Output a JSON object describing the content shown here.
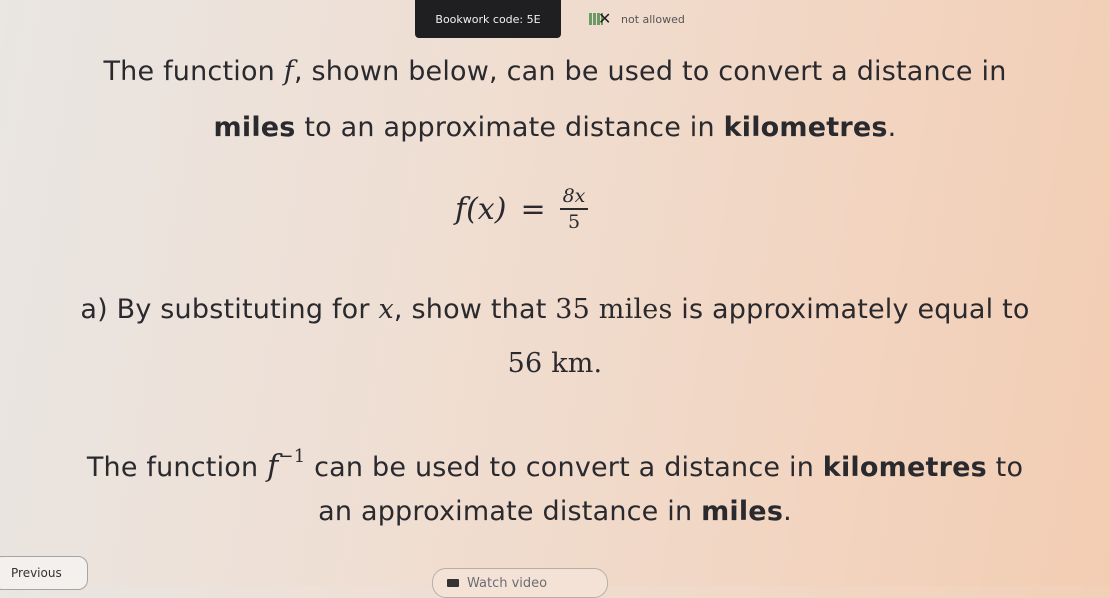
{
  "header": {
    "bookwork": "Bookwork code: 5E",
    "calculator_text": "not allowed",
    "calculator_icon": "calculator-not-allowed-icon"
  },
  "question": {
    "intro_1": "The function ",
    "intro_f": "f",
    "intro_2": ", shown below, can be used to convert a distance in",
    "intro_miles": "miles",
    "intro_3": " to an approximate distance in ",
    "intro_km": "kilometres",
    "intro_4": ".",
    "formula_lhs": "f(x)",
    "formula_eq": "=",
    "formula_num": "8x",
    "formula_den": "5",
    "part_a_1": "a) By substituting for ",
    "part_a_x": "x",
    "part_a_2": ", show that ",
    "part_a_35": "35 miles",
    "part_a_3": " is approximately equal to",
    "part_a_56": "56 km.",
    "inv_1": "The function ",
    "inv_f": "f",
    "inv_exp": "−1",
    "inv_2": " can be used to convert a distance in ",
    "inv_km": "kilometres",
    "inv_3": " to",
    "inv_4": "an approximate distance in ",
    "inv_miles": "miles",
    "inv_5": "."
  },
  "nav": {
    "previous": "Previous",
    "watch_video": "Watch video"
  }
}
